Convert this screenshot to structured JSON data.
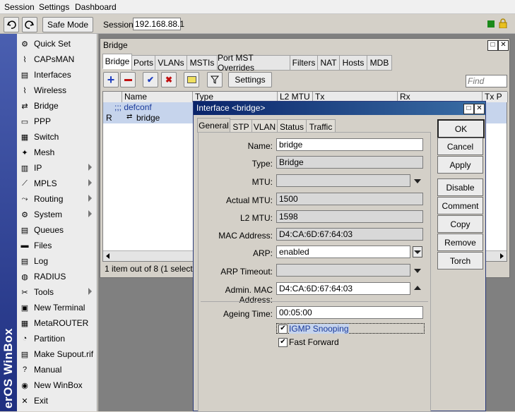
{
  "menu": [
    "Session",
    "Settings",
    "Dashboard"
  ],
  "toolbar": {
    "safe_mode": "Safe Mode",
    "session_label": "Session:",
    "session_value": "192.168.88.1"
  },
  "brand": "erOS WinBox",
  "sidebar": [
    {
      "label": "Quick Set",
      "icon": "quick-set-icon",
      "sub": false
    },
    {
      "label": "CAPsMAN",
      "icon": "capsman-icon",
      "sub": false
    },
    {
      "label": "Interfaces",
      "icon": "interfaces-icon",
      "sub": false
    },
    {
      "label": "Wireless",
      "icon": "wireless-icon",
      "sub": false
    },
    {
      "label": "Bridge",
      "icon": "bridge-icon",
      "sub": false
    },
    {
      "label": "PPP",
      "icon": "ppp-icon",
      "sub": false
    },
    {
      "label": "Switch",
      "icon": "switch-icon",
      "sub": false
    },
    {
      "label": "Mesh",
      "icon": "mesh-icon",
      "sub": false
    },
    {
      "label": "IP",
      "icon": "ip-icon",
      "sub": true
    },
    {
      "label": "MPLS",
      "icon": "mpls-icon",
      "sub": true
    },
    {
      "label": "Routing",
      "icon": "routing-icon",
      "sub": true
    },
    {
      "label": "System",
      "icon": "system-icon",
      "sub": true
    },
    {
      "label": "Queues",
      "icon": "queues-icon",
      "sub": false
    },
    {
      "label": "Files",
      "icon": "files-icon",
      "sub": false
    },
    {
      "label": "Log",
      "icon": "log-icon",
      "sub": false
    },
    {
      "label": "RADIUS",
      "icon": "radius-icon",
      "sub": false
    },
    {
      "label": "Tools",
      "icon": "tools-icon",
      "sub": true
    },
    {
      "label": "New Terminal",
      "icon": "terminal-icon",
      "sub": false
    },
    {
      "label": "MetaROUTER",
      "icon": "metarouter-icon",
      "sub": false
    },
    {
      "label": "Partition",
      "icon": "partition-icon",
      "sub": false
    },
    {
      "label": "Make Supout.rif",
      "icon": "supout-icon",
      "sub": false
    },
    {
      "label": "Manual",
      "icon": "manual-icon",
      "sub": false
    },
    {
      "label": "New WinBox",
      "icon": "winbox-icon",
      "sub": false
    },
    {
      "label": "Exit",
      "icon": "exit-icon",
      "sub": false
    }
  ],
  "bridge_window": {
    "title": "Bridge",
    "tabs": [
      "Bridge",
      "Ports",
      "VLANs",
      "MSTIs",
      "Port MST Overrides",
      "Filters",
      "NAT",
      "Hosts",
      "MDB"
    ],
    "settings_button": "Settings",
    "find_placeholder": "Find",
    "columns": [
      "Name",
      "Type",
      "L2 MTU",
      "Tx",
      "Rx",
      "Tx P"
    ],
    "comment_row": ";;; defconf",
    "row_flag": "R",
    "row_name": "bridge",
    "status": "1 item out of 8 (1 selected)"
  },
  "dialog": {
    "title": "Interface <bridge>",
    "tabs": [
      "General",
      "STP",
      "VLAN",
      "Status",
      "Traffic"
    ],
    "fields": {
      "name": {
        "label": "Name:",
        "value": "bridge"
      },
      "type": {
        "label": "Type:",
        "value": "Bridge"
      },
      "mtu": {
        "label": "MTU:",
        "value": ""
      },
      "actual_mtu": {
        "label": "Actual MTU:",
        "value": "1500"
      },
      "l2_mtu": {
        "label": "L2 MTU:",
        "value": "1598"
      },
      "mac": {
        "label": "MAC Address:",
        "value": "D4:CA:6D:67:64:03"
      },
      "arp": {
        "label": "ARP:",
        "value": "enabled"
      },
      "arp_timeout": {
        "label": "ARP Timeout:",
        "value": ""
      },
      "admin_mac": {
        "label": "Admin. MAC Address:",
        "value": "D4:CA:6D:67:64:03"
      },
      "ageing": {
        "label": "Ageing Time:",
        "value": "00:05:00"
      }
    },
    "igmp_snooping": "IGMP Snooping",
    "fast_forward": "Fast Forward",
    "buttons": [
      "OK",
      "Cancel",
      "Apply",
      "Disable",
      "Comment",
      "Copy",
      "Remove",
      "Torch"
    ]
  }
}
